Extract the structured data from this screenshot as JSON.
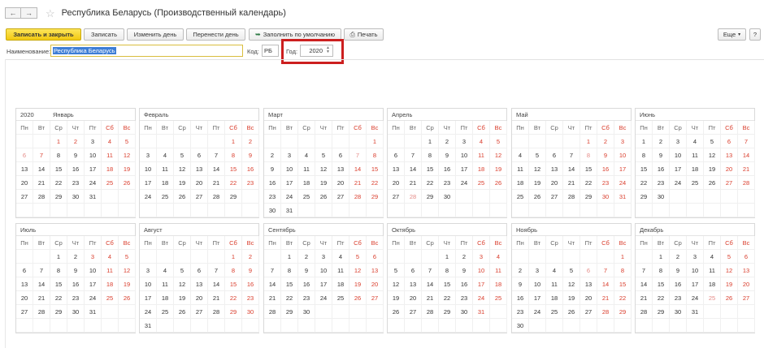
{
  "window": {
    "title": "Республика Беларусь (Производственный календарь)",
    "back_icon": "←",
    "forward_icon": "→",
    "star_icon": "☆"
  },
  "toolbar": {
    "save_close": "Записать и закрыть",
    "save": "Записать",
    "change_day": "Изменить день",
    "move_day": "Перенести день",
    "fill_default": "Заполнить по умолчанию",
    "print": "Печать",
    "more": "Еще",
    "help": "?"
  },
  "form": {
    "name_label": "Наименование:",
    "name_value": "Республика Беларусь",
    "code_label": "Код:",
    "code_value": "РБ",
    "year_label": "Год:",
    "year_value": "2020"
  },
  "calendar": {
    "year": "2020",
    "weekdays": [
      "Пн",
      "Вт",
      "Ср",
      "Чт",
      "Пт",
      "Сб",
      "Вс"
    ],
    "months": [
      {
        "name": "Январь",
        "offset": 2,
        "days": 31,
        "red": [
          1,
          2,
          4,
          5,
          7,
          11,
          12,
          18,
          19,
          25,
          26
        ],
        "pink": [
          6
        ]
      },
      {
        "name": "Февраль",
        "offset": 5,
        "days": 29,
        "red": [
          1,
          2,
          8,
          9,
          15,
          16,
          22,
          23
        ],
        "pink": []
      },
      {
        "name": "Март",
        "offset": 6,
        "days": 31,
        "red": [
          1,
          8,
          14,
          15,
          21,
          22,
          28,
          29
        ],
        "pink": [
          7
        ]
      },
      {
        "name": "Апрель",
        "offset": 2,
        "days": 30,
        "red": [
          4,
          5,
          11,
          12,
          18,
          19,
          25,
          26
        ],
        "pink": [
          28
        ]
      },
      {
        "name": "Май",
        "offset": 4,
        "days": 31,
        "red": [
          1,
          2,
          3,
          9,
          10,
          16,
          17,
          23,
          24,
          30,
          31
        ],
        "pink": [
          8
        ]
      },
      {
        "name": "Июнь",
        "offset": 0,
        "days": 30,
        "red": [
          6,
          7,
          13,
          14,
          20,
          21,
          27,
          28
        ],
        "pink": []
      },
      {
        "name": "Июль",
        "offset": 2,
        "days": 31,
        "red": [
          3,
          4,
          5,
          11,
          12,
          18,
          19,
          25,
          26
        ],
        "pink": []
      },
      {
        "name": "Август",
        "offset": 5,
        "days": 31,
        "red": [
          1,
          2,
          8,
          9,
          15,
          16,
          22,
          23,
          29,
          30
        ],
        "pink": []
      },
      {
        "name": "Сентябрь",
        "offset": 1,
        "days": 30,
        "red": [
          5,
          6,
          12,
          13,
          19,
          20,
          26,
          27
        ],
        "pink": []
      },
      {
        "name": "Октябрь",
        "offset": 3,
        "days": 31,
        "red": [
          3,
          4,
          10,
          11,
          17,
          18,
          24,
          25,
          31
        ],
        "pink": []
      },
      {
        "name": "Ноябрь",
        "offset": 6,
        "days": 30,
        "red": [
          1,
          7,
          8,
          14,
          15,
          21,
          22,
          28,
          29
        ],
        "pink": [
          6
        ]
      },
      {
        "name": "Декабрь",
        "offset": 1,
        "days": 31,
        "red": [
          5,
          6,
          12,
          13,
          19,
          20,
          26,
          27
        ],
        "pink": [
          25
        ]
      }
    ]
  }
}
